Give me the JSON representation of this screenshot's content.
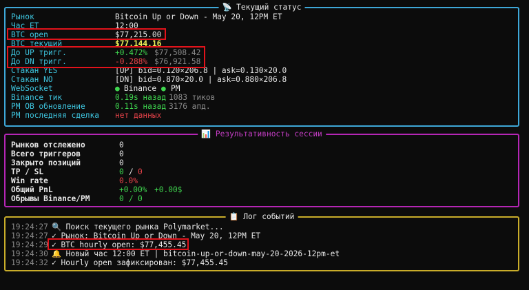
{
  "status_panel": {
    "title": "📡 Текущий статус",
    "rows": [
      {
        "label": "Рынок",
        "value": "Bitcoin Up or Down - May 20, 12PM ET"
      },
      {
        "label": "Час ET",
        "value": "12:00"
      },
      {
        "label": "BTC open",
        "value": "$77,215.00"
      },
      {
        "label": "BTC текущий",
        "value": "$77,144.16"
      },
      {
        "label": "До UP тригг.",
        "pct": "+0.472%",
        "price": "$77,508.42"
      },
      {
        "label": "До DN тригг.",
        "pct": "-0.288%",
        "price": "$76,921.58"
      },
      {
        "label": "Стакан YES",
        "value": "[UP] bid=0.120×206.8 | ask=0.130×20.0"
      },
      {
        "label": "Стакан NO",
        "value": "[DN] bid=0.870×20.0 | ask=0.880×206.8"
      },
      {
        "label": "WebSocket",
        "status1_dot": "●",
        "status1": "Binance",
        "status2_dot": "●",
        "status2": "PM"
      },
      {
        "label": "Binance тик",
        "ago": "0.19s назад",
        "count": "1083 тиков"
      },
      {
        "label": "PM OB обновление",
        "ago": "0.11s назад",
        "count": "3176 апд."
      },
      {
        "label": "PM последняя сделка",
        "value": "нет данных"
      }
    ]
  },
  "session_panel": {
    "title": "📊 Результативность сессии",
    "rows": [
      {
        "label": "Рынков отслежено",
        "value": "0"
      },
      {
        "label": "Всего триггеров",
        "value": "0"
      },
      {
        "label": "Закрыто позиций",
        "value": "0"
      },
      {
        "label": "TP / SL",
        "tp": "0",
        "sep": "/",
        "sl": "0"
      },
      {
        "label": "Win rate",
        "value": "0.0%"
      },
      {
        "label": "Общий PnL",
        "pct": "+0.00%",
        "usd": "+0.00$"
      },
      {
        "label": "Обрывы Binance/PM",
        "a": "0",
        "sep": "/",
        "b": "0"
      }
    ]
  },
  "log_panel": {
    "title": "📋 Лог событий",
    "entries": [
      {
        "time": "19:24:27",
        "text": "🔍 Поиск текущего рынка Polymarket..."
      },
      {
        "time": "19:24:27",
        "text": "✓ Рынок: Bitcoin Up or Down - May 20, 12PM ET"
      },
      {
        "time": "19:24:29",
        "text": "✓ BTC hourly open: $77,455.45"
      },
      {
        "time": "19:24:30",
        "text": "🔔 Новый час 12:00 ET | bitcoin-up-or-down-may-20-2026-12pm-et"
      },
      {
        "time": "19:24:32",
        "text": "✓ Hourly open зафиксирован: $77,455.45"
      }
    ]
  },
  "colors": {
    "status_border": "#3ea8d8",
    "session_border": "#b526b5",
    "log_border": "#c9ad2a",
    "highlight": "#e2131b"
  }
}
